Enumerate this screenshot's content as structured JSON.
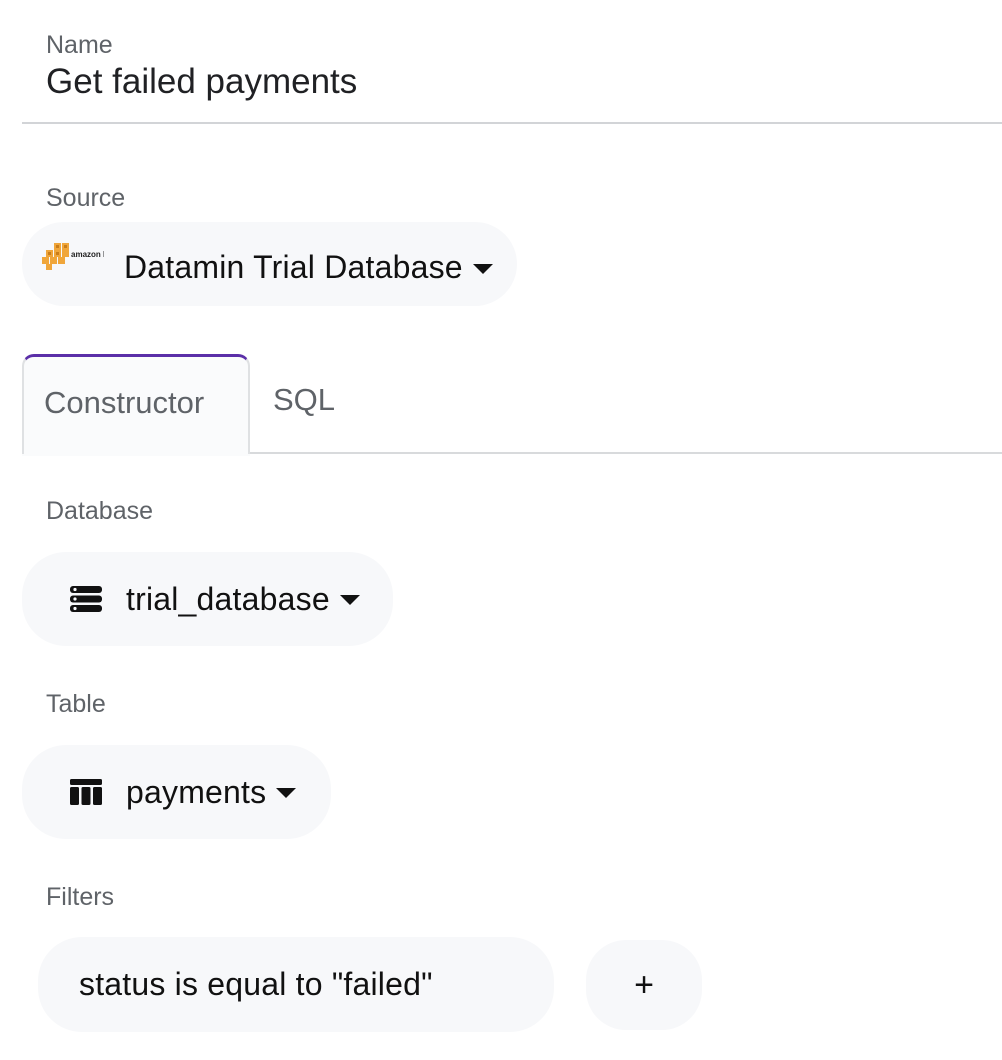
{
  "name": {
    "label": "Name",
    "value": "Get failed payments"
  },
  "source": {
    "label": "Source",
    "selected": "Datamin Trial Database",
    "logo_icon": "amazon-rds-logo",
    "logo_text": "amazon RDS"
  },
  "tabs": [
    {
      "label": "Constructor",
      "active": true
    },
    {
      "label": "SQL",
      "active": false
    }
  ],
  "database": {
    "label": "Database",
    "selected": "trial_database",
    "icon": "database-icon"
  },
  "table": {
    "label": "Table",
    "selected": "payments",
    "icon": "table-icon"
  },
  "filters": {
    "label": "Filters",
    "items": [
      {
        "text": "status is equal to \"failed\""
      }
    ],
    "add_label": "+"
  },
  "colors": {
    "accent": "#5b2fa8",
    "pill_bg": "#f7f8fa",
    "label": "#5f6368"
  }
}
